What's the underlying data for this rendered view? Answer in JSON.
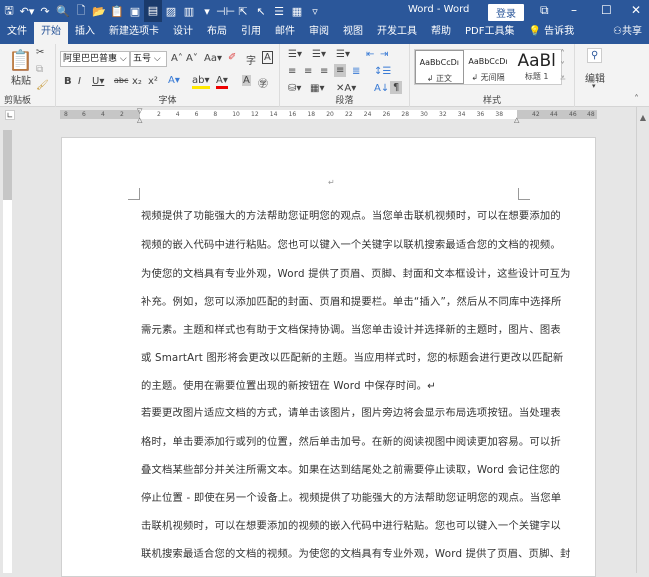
{
  "titlebar": {
    "title": "Word - Word",
    "login": "登录"
  },
  "tabs": [
    "文件",
    "开始",
    "插入",
    "新建选项卡",
    "设计",
    "布局",
    "引用",
    "邮件",
    "审阅",
    "视图",
    "开发工具",
    "帮助",
    "PDF工具集",
    "告诉我",
    "共享"
  ],
  "ribbon": {
    "clipboard": {
      "paste": "粘贴",
      "label": "剪贴板"
    },
    "font": {
      "name": "阿里巴巴普惠",
      "size": "五号",
      "label": "字体"
    },
    "paragraph": {
      "label": "段落"
    },
    "styles": {
      "label": "样式",
      "items": [
        {
          "preview": "AaBbCcDı",
          "name": "↲ 正文"
        },
        {
          "preview": "AaBbCcDı",
          "name": "↲ 无间隔"
        },
        {
          "preview": "AaBl",
          "name": "标题 1"
        }
      ]
    },
    "editing": {
      "label": "编辑"
    }
  },
  "ruler": {
    "left": [
      "8",
      "6",
      "4",
      "2"
    ],
    "main": [
      "2",
      "4",
      "6",
      "8",
      "10",
      "12",
      "14",
      "16",
      "18",
      "20",
      "22",
      "24",
      "26",
      "28",
      "30",
      "32",
      "34",
      "36",
      "38"
    ],
    "right": [
      "42",
      "44",
      "46",
      "48"
    ]
  },
  "document": {
    "lines": [
      "视频提供了功能强大的方法帮助您证明您的观点。当您单击联机视频时，可以在想要添加的",
      "视频的嵌入代码中进行粘贴。您也可以键入一个关键字以联机搜索最适合您的文档的视频。",
      "为使您的文档具有专业外观，Word 提供了页眉、页脚、封面和文本框设计，这些设计可互为",
      "补充。例如，您可以添加匹配的封面、页眉和提要栏。单击“插入”，然后从不同库中选择所",
      "需元素。主题和样式也有助于文档保持协调。当您单击设计并选择新的主题时，图片、图表",
      "或 SmartArt 图形将会更改以匹配新的主题。当应用样式时，您的标题会进行更改以匹配新",
      "的主题。使用在需要位置出现的新按钮在 Word 中保存时间。↵",
      "若要更改图片适应文档的方式，请单击该图片，图片旁边将会显示布局选项按钮。当处理表",
      "格时，单击要添加行或列的位置，然后单击加号。在新的阅读视图中阅读更加容易。可以折",
      "叠文档某些部分并关注所需文本。如果在达到结尾处之前需要停止读取，Word 会记住您的",
      "停止位置 - 即使在另一个设备上。视频提供了功能强大的方法帮助您证明您的观点。当您单",
      "击联机视频时，可以在想要添加的视频的嵌入代码中进行粘贴。您也可以键入一个关键字以",
      "联机搜索最适合您的文档的视频。为使您的文档具有专业外观，Word 提供了页眉、页脚、封"
    ],
    "para_mark": "↵"
  }
}
